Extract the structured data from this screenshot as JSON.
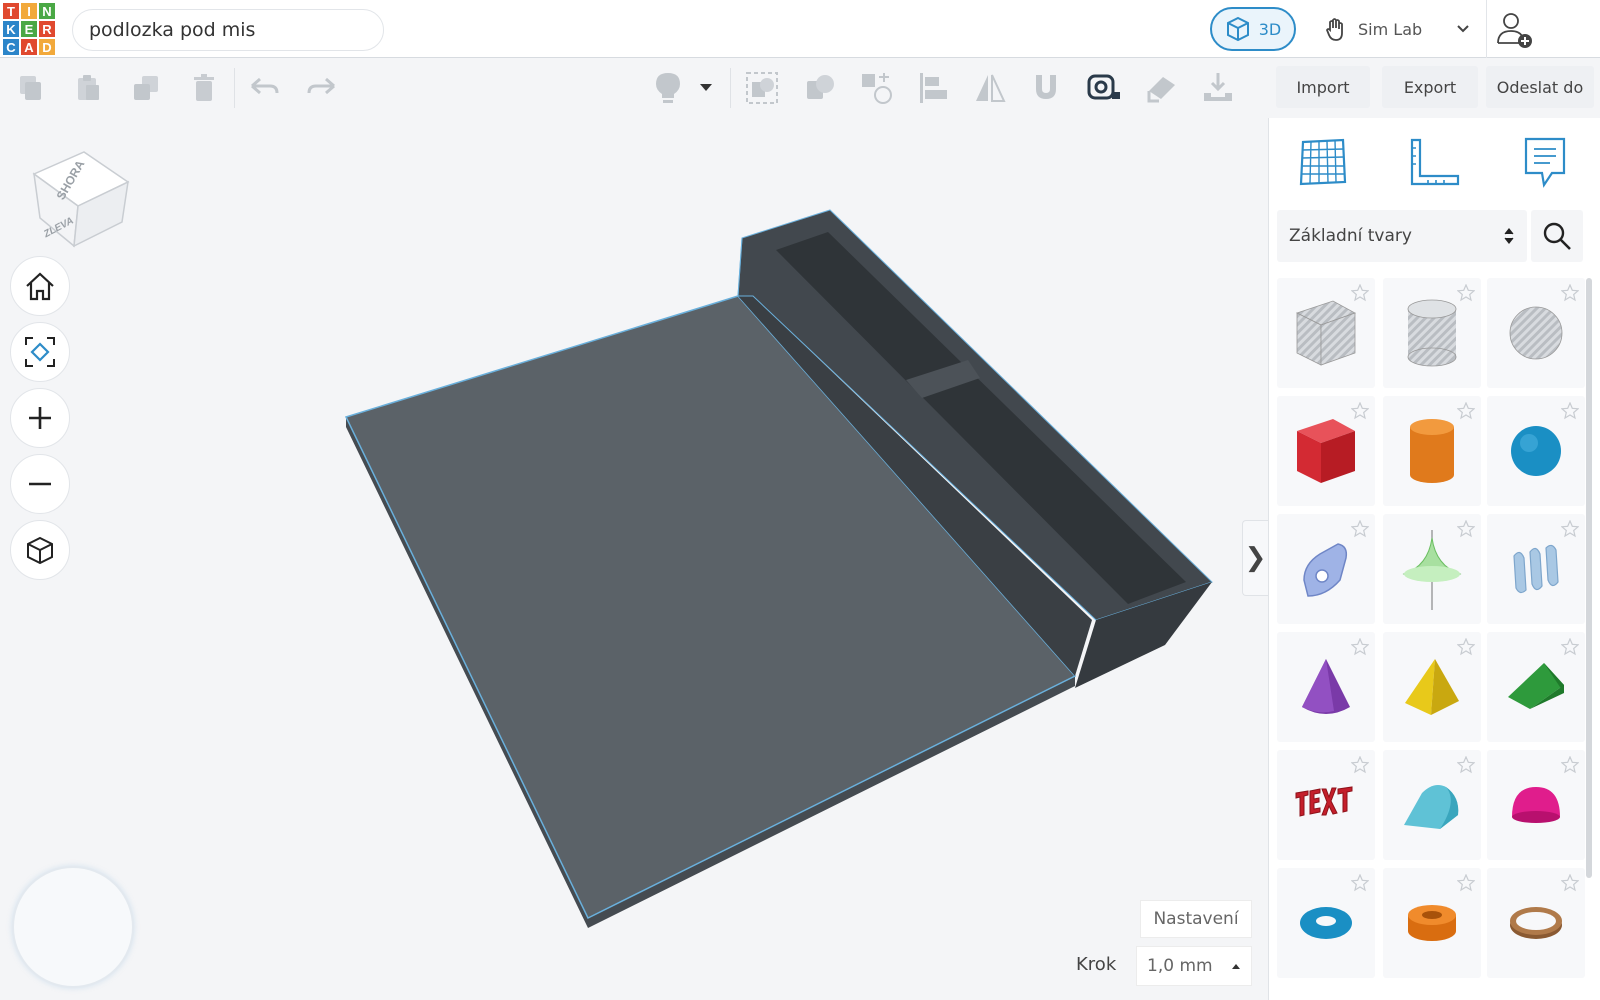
{
  "app": {
    "logo_letters": [
      "T",
      "I",
      "N",
      "K",
      "E",
      "R",
      "C",
      "A",
      "D"
    ],
    "logo_colors": [
      "#e0492f",
      "#f2a93b",
      "#4aa845",
      "#2c85c9",
      "#4aa845",
      "#e0492f",
      "#2c85c9",
      "#e0492f",
      "#f2a93b"
    ],
    "project_title": "podlozka pod mis"
  },
  "header": {
    "mode_label": "3D",
    "simlab_label": "Sim Lab"
  },
  "toolbar": {
    "import_label": "Import",
    "export_label": "Export",
    "send_label": "Odeslat do"
  },
  "viewcube": {
    "top_label": "SHORA",
    "left_label": "ZLEVA"
  },
  "panel": {
    "category": "Základní tvary",
    "shapes": [
      "box-hole-icon",
      "cylinder-hole-icon",
      "sphere-hole-icon",
      "box-icon",
      "cylinder-icon",
      "sphere-icon",
      "scribble-icon",
      "paraboloid-icon",
      "shape-generator-icon",
      "cone-icon",
      "pyramid-icon",
      "roof-icon",
      "text-icon",
      "half-cylinder-icon",
      "half-sphere-icon",
      "torus-icon",
      "tube-icon",
      "ring-icon"
    ],
    "collapse_glyph": "❯"
  },
  "workplane": {
    "settings_label": "Nastavení",
    "snap_label": "Krok",
    "snap_value": "1,0 mm"
  },
  "colors": {
    "accent": "#2d8cc8",
    "model": "#5b6268"
  }
}
